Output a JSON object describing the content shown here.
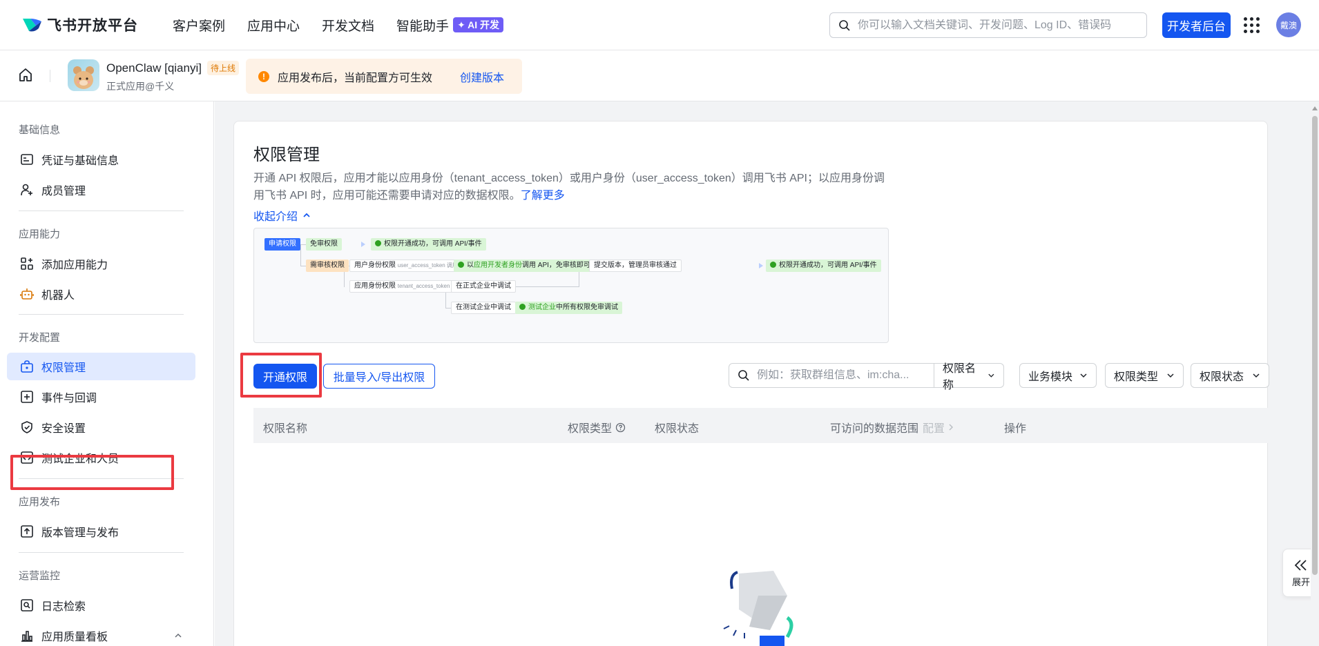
{
  "topnav": {
    "logo_text": "飞书开放平台",
    "links": [
      "客户案例",
      "应用中心",
      "开发文档",
      "智能助手"
    ],
    "ai_badge": "✦ AI 开发",
    "search_placeholder": "你可以输入文档关键词、开发问题、Log ID、错误码",
    "dev_console": "开发者后台",
    "user_avatar": "戴澳"
  },
  "appbar": {
    "app_name": "OpenClaw [qianyi]",
    "status_badge": "待上线",
    "subtitle": "正式应用@千义",
    "notice_icon": "!",
    "notice_text": "应用发布后，当前配置方可生效",
    "notice_link": "创建版本"
  },
  "sidebar": {
    "sections": [
      {
        "title": "基础信息",
        "items": [
          {
            "label": "凭证与基础信息",
            "icon": "id-card-icon"
          },
          {
            "label": "成员管理",
            "icon": "user-add-icon"
          }
        ]
      },
      {
        "title": "应用能力",
        "items": [
          {
            "label": "添加应用能力",
            "icon": "apps-add-icon"
          },
          {
            "label": "机器人",
            "icon": "robot-icon"
          }
        ]
      },
      {
        "title": "开发配置",
        "items": [
          {
            "label": "权限管理",
            "icon": "permission-icon",
            "active": true
          },
          {
            "label": "事件与回调",
            "icon": "event-icon"
          },
          {
            "label": "安全设置",
            "icon": "shield-icon"
          },
          {
            "label": "测试企业和人员",
            "icon": "code-box-icon"
          }
        ]
      },
      {
        "title": "应用发布",
        "items": [
          {
            "label": "版本管理与发布",
            "icon": "upload-box-icon"
          }
        ]
      },
      {
        "title": "运营监控",
        "items": [
          {
            "label": "日志检索",
            "icon": "log-search-icon"
          },
          {
            "label": "应用质量看板",
            "icon": "bar-chart-icon"
          }
        ]
      }
    ]
  },
  "main": {
    "title": "权限管理",
    "desc": "开通 API 权限后，应用才能以应用身份（tenant_access_token）或用户身份（user_access_token）调用飞书 API；以应用身份调用飞书 API 时，应用可能还需要申请对应的数据权限。",
    "learn_more": "了解更多",
    "collapse": "收起介绍",
    "flow": {
      "apply": "申请权限",
      "free": "免审权限",
      "free_result": "权限开通成功，可调用 API/事件",
      "review": "需审核权限",
      "user_perm": "用户身份权限",
      "user_perm_token": "user_access_token 调用",
      "dev_debug_pre": "以",
      "dev_debug_green": "应用开发者身份",
      "dev_debug_post": "调用 API，免审核即可调试",
      "submit": "提交版本，管理员审核通过",
      "final_result": "权限开通成功，可调用 API/事件",
      "tenant_perm": "应用身份权限",
      "tenant_perm_token": "tenant_access_token 调用",
      "prod_debug": "在正式企业中调试",
      "test_debug": "在测试企业中调试",
      "test_free_green": "测试企业",
      "test_free_post": "中所有权限免审调试"
    },
    "btn_open": "开通权限",
    "btn_batch": "批量导入/导出权限",
    "filter_placeholder": "例如：获取群组信息、im:cha...",
    "filters": [
      "权限名称",
      "业务模块",
      "权限类型",
      "权限状态"
    ],
    "columns": {
      "name": "权限名称",
      "type": "权限类型",
      "status": "权限状态",
      "scope": "可访问的数据范围",
      "config": "配置",
      "action": "操作"
    },
    "expand": "展开"
  }
}
